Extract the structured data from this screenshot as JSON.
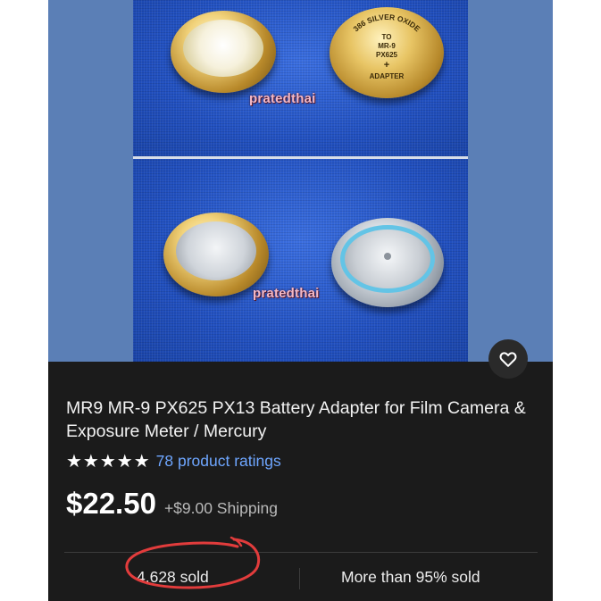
{
  "listing": {
    "title": "MR9 MR-9 PX625 PX13 Battery Adapter for Film Camera & Exposure Meter / Mercury",
    "stars_display": "★★★★★",
    "rating_value": 5,
    "ratings_link": "78 product ratings",
    "price": "$22.50",
    "shipping": "+$9.00 Shipping",
    "sold_count": "4,628 sold",
    "sold_share": "More than 95% sold"
  },
  "gallery": {
    "watermark": "pratedthai",
    "adapter_lid_text": [
      "386 SILVER OXIDE",
      "TO",
      "MR-9",
      "PX625",
      "+",
      "ADAPTER"
    ]
  },
  "icons": {
    "favorite": "heart-icon"
  },
  "colors": {
    "card_bg": "#1b1b1b",
    "link": "#6ea6ff",
    "annotation": "#e23c3c",
    "backdrop": "#5b7fb6"
  }
}
